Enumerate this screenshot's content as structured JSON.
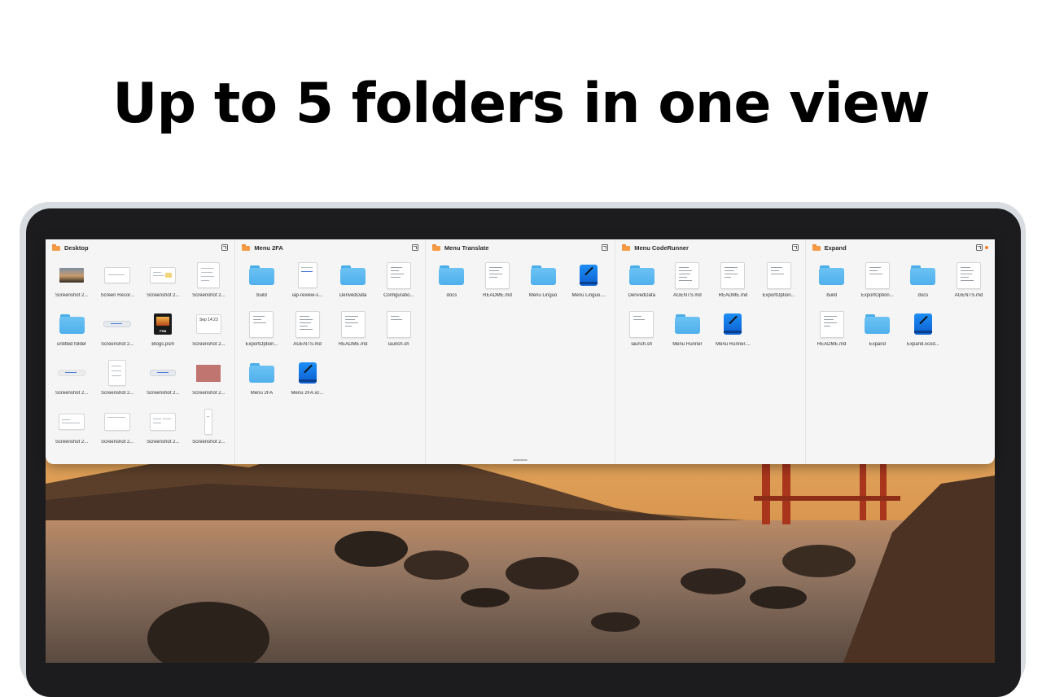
{
  "headline": "Up to 5 folders in one view",
  "colors": {
    "folder_blue": "#4fb0ec",
    "header_folder_orange": "#f59a45",
    "panel_bg": "#f5f5f5"
  },
  "columns": [
    {
      "title": "Desktop",
      "items": [
        {
          "label": "Screenshot 2...",
          "icon": "photo-thumbnail"
        },
        {
          "label": "Screen Recor...",
          "icon": "screenshot-thumbnail"
        },
        {
          "label": "Screenshot 2...",
          "icon": "screenshot-thumbnail"
        },
        {
          "label": "Screenshot 2...",
          "icon": "screenshot-thumbnail"
        },
        {
          "label": "untitled folder",
          "icon": "folder-icon"
        },
        {
          "label": "Screenshot 2...",
          "icon": "pill-thumbnail"
        },
        {
          "label": "Blogs.psm",
          "icon": "psb-file-icon"
        },
        {
          "label": "Screenshot 2...",
          "icon": "calendar-thumbnail",
          "caption": "Sep 14:23"
        },
        {
          "label": "Screenshot 2...",
          "icon": "pill-thumbnail"
        },
        {
          "label": "Screenshot 2...",
          "icon": "screenshot-thumbnail"
        },
        {
          "label": "Screenshot 2...",
          "icon": "pill-thumbnail"
        },
        {
          "label": "Screenshot 2...",
          "icon": "swatch-thumbnail"
        },
        {
          "label": "Screenshot 2...",
          "icon": "screenshot-thumbnail"
        },
        {
          "label": "Screenshot 2...",
          "icon": "screenshot-thumbnail"
        },
        {
          "label": "Screenshot 2...",
          "icon": "screenshot-thumbnail"
        },
        {
          "label": "Screenshot 2...",
          "icon": "screenshot-thumbnail"
        }
      ]
    },
    {
      "title": "Menu 2FA",
      "items": [
        {
          "label": "build",
          "icon": "folder-icon"
        },
        {
          "label": "iap-review-s...",
          "icon": "screenshot-thumbnail"
        },
        {
          "label": "DerivedData",
          "icon": "folder-icon"
        },
        {
          "label": "Configuratio...",
          "icon": "document-icon"
        },
        {
          "label": "ExportOption...",
          "icon": "document-icon"
        },
        {
          "label": "AGENTS.md",
          "icon": "document-icon"
        },
        {
          "label": "README.md",
          "icon": "document-icon"
        },
        {
          "label": "launch.sh",
          "icon": "document-icon"
        },
        {
          "label": "Menu 2FA",
          "icon": "folder-icon"
        },
        {
          "label": "Menu 2FA.xc...",
          "icon": "xcode-project-icon"
        }
      ]
    },
    {
      "title": "Menu Translate",
      "items": [
        {
          "label": "docs",
          "icon": "folder-icon"
        },
        {
          "label": "README.md",
          "icon": "document-icon"
        },
        {
          "label": "Menu Linguo",
          "icon": "folder-icon"
        },
        {
          "label": "Menu Linguo....",
          "icon": "xcode-project-icon"
        }
      ]
    },
    {
      "title": "Menu CodeRunner",
      "items": [
        {
          "label": "DerivedData",
          "icon": "folder-icon"
        },
        {
          "label": "AGENTS.md",
          "icon": "document-icon"
        },
        {
          "label": "README.md",
          "icon": "document-icon"
        },
        {
          "label": "ExportOption...",
          "icon": "document-icon"
        },
        {
          "label": "launch.sh",
          "icon": "document-icon"
        },
        {
          "label": "Menu Runner",
          "icon": "folder-icon"
        },
        {
          "label": "Menu Runner....",
          "icon": "xcode-project-icon"
        }
      ]
    },
    {
      "title": "Expand",
      "items": [
        {
          "label": "build",
          "icon": "folder-icon"
        },
        {
          "label": "ExportOption...",
          "icon": "document-icon"
        },
        {
          "label": "docs",
          "icon": "folder-icon"
        },
        {
          "label": "AGENTS.md",
          "icon": "document-icon"
        },
        {
          "label": "README.md",
          "icon": "document-icon"
        },
        {
          "label": "Expand",
          "icon": "folder-icon"
        },
        {
          "label": "Expand.xcod...",
          "icon": "xcode-project-icon"
        }
      ]
    }
  ]
}
